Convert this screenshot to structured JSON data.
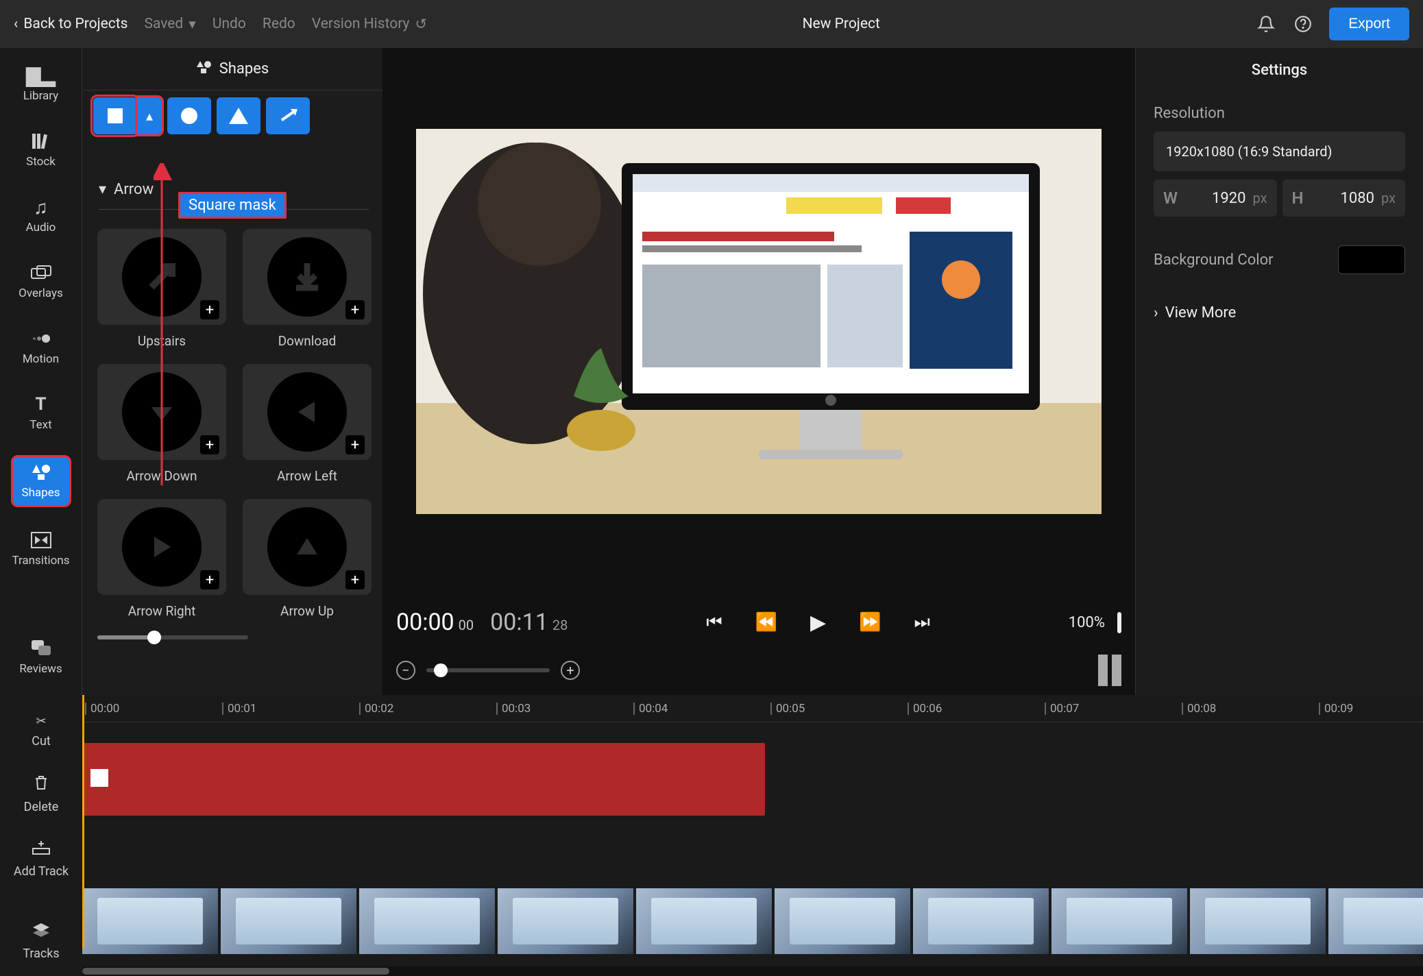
{
  "topbar": {
    "back": "Back to Projects",
    "saved": "Saved",
    "undo": "Undo",
    "redo": "Redo",
    "history": "Version History",
    "title": "New Project",
    "export": "Export"
  },
  "rail": {
    "library": "Library",
    "stock": "Stock",
    "audio": "Audio",
    "overlays": "Overlays",
    "motion": "Motion",
    "text": "Text",
    "shapes": "Shapes",
    "transitions": "Transitions",
    "reviews": "Reviews"
  },
  "sidepanel": {
    "title": "Shapes",
    "tooltip": "Square mask",
    "section": "Arrow",
    "items": [
      {
        "label": "Upstairs"
      },
      {
        "label": "Download"
      },
      {
        "label": "Arrow Down"
      },
      {
        "label": "Arrow Left"
      },
      {
        "label": "Arrow Right"
      },
      {
        "label": "Arrow Up"
      }
    ]
  },
  "transport": {
    "cur": "00:00",
    "cur_frames": "00",
    "dur": "00:11",
    "dur_frames": "28",
    "zoom_pct": "100%"
  },
  "settings": {
    "title": "Settings",
    "resolution_label": "Resolution",
    "resolution_value": "1920x1080 (16:9 Standard)",
    "w_label": "W",
    "w_value": "1920",
    "w_unit": "px",
    "h_label": "H",
    "h_value": "1080",
    "h_unit": "px",
    "bg_label": "Background Color",
    "bg_color": "#000000",
    "view_more": "View More"
  },
  "bottom_rail": {
    "cut": "Cut",
    "delete": "Delete",
    "add_track": "Add Track",
    "tracks": "Tracks"
  },
  "ruler_ticks": [
    "00:00",
    "00:01",
    "00:02",
    "00:03",
    "00:04",
    "00:05",
    "00:06",
    "00:07",
    "00:08",
    "00:09"
  ]
}
